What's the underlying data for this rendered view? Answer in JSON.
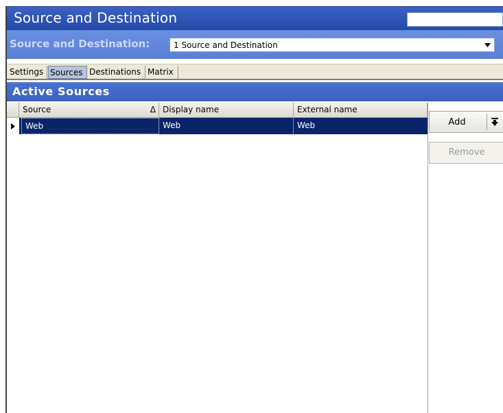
{
  "window": {
    "title": "Source and Destination"
  },
  "selector": {
    "label": "Source and Destination:",
    "value": "1 Source and Destination"
  },
  "tabs": [
    {
      "label": "Settings",
      "active": false
    },
    {
      "label": "Sources",
      "active": true
    },
    {
      "label": "Destinations",
      "active": false
    },
    {
      "label": "Matrix",
      "active": false
    }
  ],
  "section": {
    "title": "Active Sources"
  },
  "grid": {
    "columns": [
      "Source",
      "Display name",
      "External name"
    ],
    "sort_indicator": "Δ",
    "rows": [
      {
        "source": "Web",
        "display_name": "Web",
        "external_name": "Web",
        "selected": true
      }
    ]
  },
  "buttons": {
    "add": "Add",
    "remove": "Remove"
  },
  "colors": {
    "titlebar": "#2349a8",
    "selector_bar": "#5a7fd6",
    "selection": "#0a246a"
  }
}
